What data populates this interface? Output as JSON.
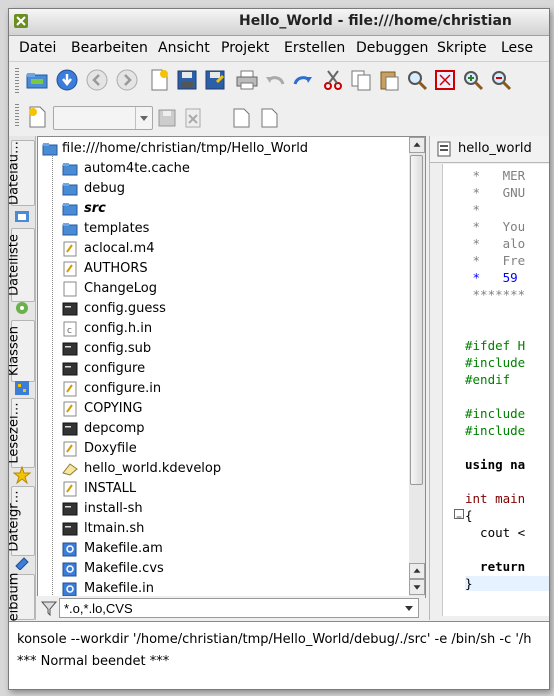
{
  "window": {
    "title": "Hello_World - file:///home/christian"
  },
  "menu": [
    "Datei",
    "Bearbeiten",
    "Ansicht",
    "Projekt",
    "Erstellen",
    "Debuggen",
    "Skripte",
    "Lese"
  ],
  "sidetabs": [
    "Dateiau…",
    "Dateiliste",
    "Klassen",
    "Lesezei…",
    "Dateigr…",
    "eibaum"
  ],
  "tree": {
    "root": "file:///home/christian/tmp/Hello_World",
    "items": [
      {
        "name": "autom4te.cache",
        "type": "folder"
      },
      {
        "name": "debug",
        "type": "folder"
      },
      {
        "name": "src",
        "type": "folder",
        "emphasis": true
      },
      {
        "name": "templates",
        "type": "folder"
      },
      {
        "name": "aclocal.m4",
        "type": "text"
      },
      {
        "name": "AUTHORS",
        "type": "text"
      },
      {
        "name": "ChangeLog",
        "type": "blank"
      },
      {
        "name": "config.guess",
        "type": "exec"
      },
      {
        "name": "config.h.in",
        "type": "c"
      },
      {
        "name": "config.sub",
        "type": "exec"
      },
      {
        "name": "configure",
        "type": "exec"
      },
      {
        "name": "configure.in",
        "type": "text"
      },
      {
        "name": "COPYING",
        "type": "text"
      },
      {
        "name": "depcomp",
        "type": "exec"
      },
      {
        "name": "Doxyfile",
        "type": "text"
      },
      {
        "name": "hello_world.kdevelop",
        "type": "kdev"
      },
      {
        "name": "INSTALL",
        "type": "text"
      },
      {
        "name": "install-sh",
        "type": "exec"
      },
      {
        "name": "ltmain.sh",
        "type": "exec"
      },
      {
        "name": "Makefile.am",
        "type": "make"
      },
      {
        "name": "Makefile.cvs",
        "type": "make"
      },
      {
        "name": "Makefile.in",
        "type": "make"
      }
    ]
  },
  "filter": {
    "value": "*.o,*.lo,CVS"
  },
  "editor": {
    "tab": "hello_world",
    "lines": [
      {
        "t": " *   MER",
        "c": "c-com"
      },
      {
        "t": " *   GNU",
        "c": "c-com"
      },
      {
        "t": " *",
        "c": "c-com"
      },
      {
        "t": " *   You",
        "c": "c-com"
      },
      {
        "t": " *   alo",
        "c": "c-com"
      },
      {
        "t": " *   Fre",
        "c": "c-com"
      },
      {
        "t": " *   59",
        "c": "c-blue"
      },
      {
        "t": " *******",
        "c": "c-com"
      },
      {
        "t": "",
        "c": ""
      },
      {
        "t": "",
        "c": ""
      },
      {
        "t": "#ifdef H",
        "c": "c-pp"
      },
      {
        "t": "#include",
        "c": "c-pp"
      },
      {
        "t": "#endif",
        "c": "c-pp"
      },
      {
        "t": "",
        "c": ""
      },
      {
        "t": "#include",
        "c": "c-pp"
      },
      {
        "t": "#include",
        "c": "c-pp"
      },
      {
        "t": "",
        "c": ""
      },
      {
        "t": "using na",
        "c": "c-kw"
      },
      {
        "t": "",
        "c": ""
      },
      {
        "t": "int main",
        "c": "c-type"
      },
      {
        "t": "{",
        "c": ""
      },
      {
        "t": "  cout <",
        "c": ""
      },
      {
        "t": "",
        "c": ""
      },
      {
        "t": "  return",
        "c": "c-kw"
      },
      {
        "t": "}",
        "c": "c-hl"
      }
    ]
  },
  "output": {
    "lines": [
      "konsole --workdir '/home/christian/tmp/Hello_World/debug/./src' -e /bin/sh -c '/h",
      "*** Normal beendet ***"
    ]
  }
}
